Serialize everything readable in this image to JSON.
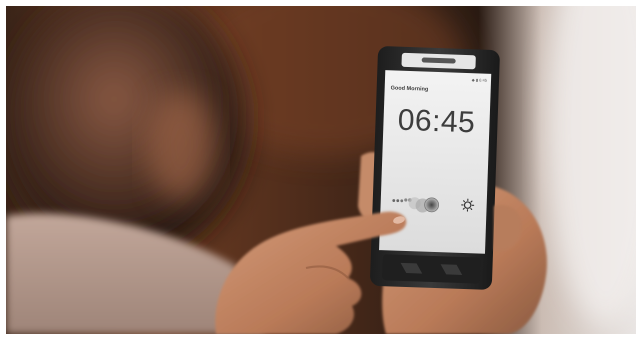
{
  "photo": {
    "subject": "Hand holding a smartphone showing an alarm screen while a finger swipes to dismiss",
    "colors": {
      "background_warm": "#6b3b22",
      "background_dark": "#1f140e",
      "skin": "#c48a68",
      "phone_body": "#2b2b2b",
      "screen": "#ececec",
      "text_dark": "#3d3d3d"
    }
  },
  "phone_screen": {
    "greeting": "Good Morning",
    "time": "06:45",
    "status": "◆ ▮ 6:45",
    "left_icon": "snooze-dots-icon",
    "center_icon": "swipe-knob-icon",
    "right_icon": "sun-icon"
  }
}
